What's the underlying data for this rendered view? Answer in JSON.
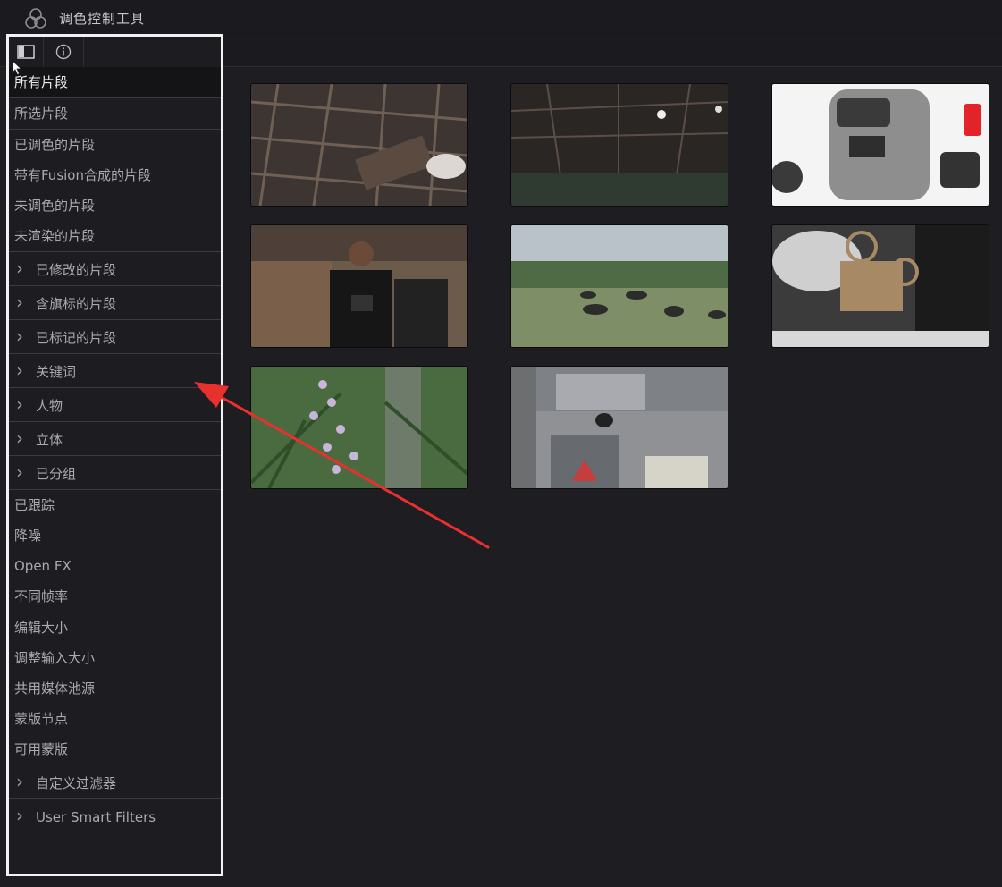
{
  "app": {
    "title": "调色控制工具",
    "icon": "color-circles-icon"
  },
  "sidebar": {
    "tools": [
      {
        "name": "panel-toggle-icon"
      },
      {
        "name": "info-icon"
      }
    ],
    "items": [
      {
        "label": "所有片段",
        "active": true
      },
      {
        "label": "所选片段"
      },
      {
        "label": "已调色的片段"
      },
      {
        "label": "带有Fusion合成的片段"
      },
      {
        "label": "未调色的片段"
      },
      {
        "label": "未渲染的片段"
      },
      {
        "label": "已修改的片段",
        "expandable": true
      },
      {
        "label": "含旗标的片段",
        "expandable": true
      },
      {
        "label": "已标记的片段",
        "expandable": true
      },
      {
        "label": "关键词",
        "expandable": true
      },
      {
        "label": "人物",
        "expandable": true
      },
      {
        "label": "立体",
        "expandable": true
      },
      {
        "label": "已分组",
        "expandable": true
      },
      {
        "label": "已跟踪"
      },
      {
        "label": "降噪"
      },
      {
        "label": "Open FX"
      },
      {
        "label": "不同帧率"
      },
      {
        "label": "编辑大小"
      },
      {
        "label": "调整输入大小"
      },
      {
        "label": "共用媒体池源"
      },
      {
        "label": "蒙版节点"
      },
      {
        "label": "可用蒙版"
      },
      {
        "label": "自定义过滤器",
        "expandable": true
      },
      {
        "label": "User Smart Filters",
        "expandable": true
      }
    ]
  },
  "thumbnails": [
    {
      "name": "clip-scaffold-ceiling",
      "scene": "scaffold"
    },
    {
      "name": "clip-stage-rigging",
      "scene": "stage"
    },
    {
      "name": "clip-drone-case",
      "scene": "case"
    },
    {
      "name": "clip-man-camera",
      "scene": "man"
    },
    {
      "name": "clip-buffalo-field",
      "scene": "field"
    },
    {
      "name": "clip-toy-projector",
      "scene": "projector"
    },
    {
      "name": "clip-purple-flowers",
      "scene": "flowers"
    },
    {
      "name": "clip-bird-trashcan",
      "scene": "bird"
    }
  ],
  "colors": {
    "highlight_border": "#f2f2f2",
    "arrow": "#e8302f",
    "background": "#1d1d22"
  }
}
